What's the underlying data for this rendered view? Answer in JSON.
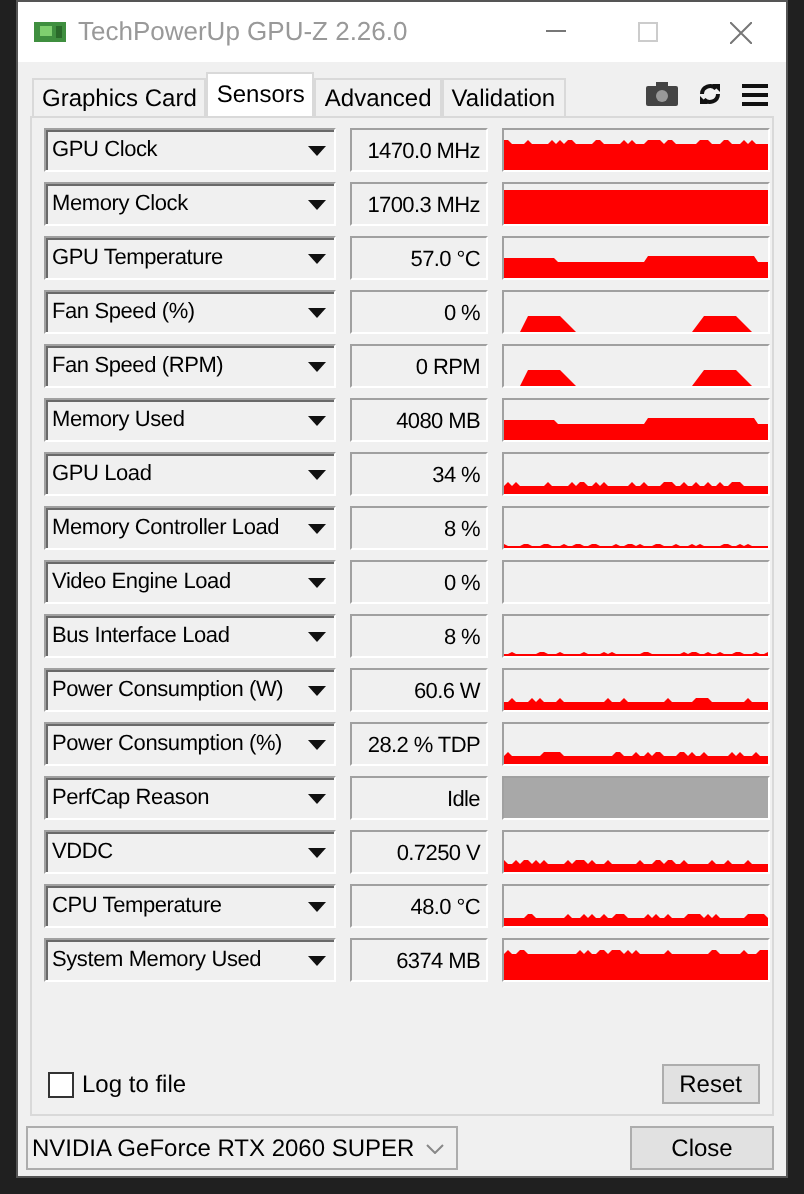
{
  "window": {
    "title": "TechPowerUp GPU-Z 2.26.0"
  },
  "tabs": [
    {
      "label": "Graphics Card",
      "selected": false
    },
    {
      "label": "Sensors",
      "selected": true
    },
    {
      "label": "Advanced",
      "selected": false
    },
    {
      "label": "Validation",
      "selected": false
    }
  ],
  "sensors": [
    {
      "name": "GPU Clock",
      "value": "1470.0 MHz",
      "kind": "high"
    },
    {
      "name": "Memory Clock",
      "value": "1700.3 MHz",
      "kind": "full"
    },
    {
      "name": "GPU Temperature",
      "value": "57.0 °C",
      "kind": "mid"
    },
    {
      "name": "Fan Speed (%)",
      "value": "0 %",
      "kind": "bumps"
    },
    {
      "name": "Fan Speed (RPM)",
      "value": "0 RPM",
      "kind": "bumps"
    },
    {
      "name": "Memory Used",
      "value": "4080 MB",
      "kind": "mid"
    },
    {
      "name": "GPU Load",
      "value": "34 %",
      "kind": "low"
    },
    {
      "name": "Memory Controller Load",
      "value": "8 %",
      "kind": "line"
    },
    {
      "name": "Video Engine Load",
      "value": "0 %",
      "kind": "empty"
    },
    {
      "name": "Bus Interface Load",
      "value": "8 %",
      "kind": "line"
    },
    {
      "name": "Power Consumption (W)",
      "value": "60.6 W",
      "kind": "low"
    },
    {
      "name": "Power Consumption (%)",
      "value": "28.2 % TDP",
      "kind": "low"
    },
    {
      "name": "PerfCap Reason",
      "value": "Idle",
      "kind": "status"
    },
    {
      "name": "VDDC",
      "value": "0.7250 V",
      "kind": "low"
    },
    {
      "name": "CPU Temperature",
      "value": "48.0 °C",
      "kind": "low"
    },
    {
      "name": "System Memory Used",
      "value": "6374 MB",
      "kind": "high"
    }
  ],
  "log_to_file": {
    "label": "Log to file",
    "checked": false
  },
  "reset_button": "Reset",
  "gpu_select": {
    "value": "NVIDIA GeForce RTX 2060 SUPER"
  },
  "close_button": "Close"
}
